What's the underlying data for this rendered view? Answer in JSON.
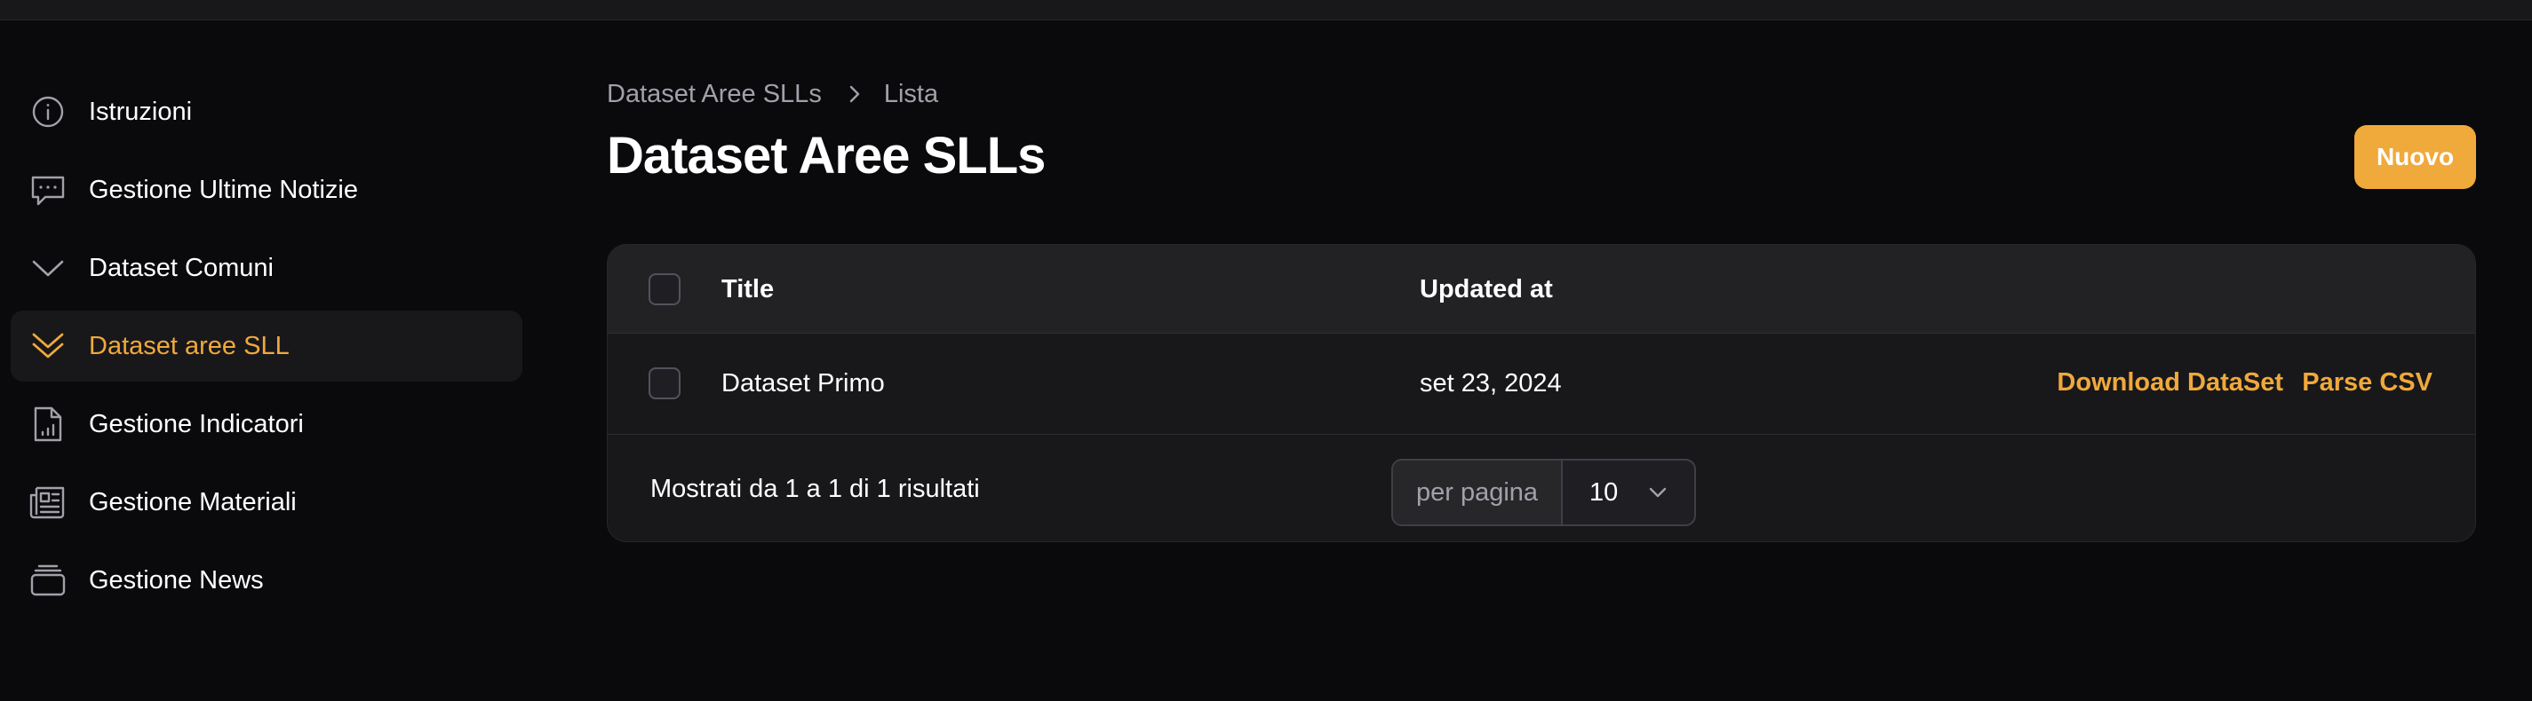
{
  "sidebar": {
    "items": [
      {
        "label": "Istruzioni",
        "icon": "info-circle-icon",
        "active": false
      },
      {
        "label": "Gestione Ultime Notizie",
        "icon": "chat-bubble-icon",
        "active": false
      },
      {
        "label": "Dataset Comuni",
        "icon": "chevron-down-icon",
        "active": false
      },
      {
        "label": "Dataset aree SLL",
        "icon": "double-chevron-down-icon",
        "active": true
      },
      {
        "label": "Gestione Indicatori",
        "icon": "document-chart-icon",
        "active": false
      },
      {
        "label": "Gestione Materiali",
        "icon": "newspaper-icon",
        "active": false
      },
      {
        "label": "Gestione News",
        "icon": "stack-icon",
        "active": false
      }
    ]
  },
  "breadcrumb": {
    "parent": "Dataset Aree SLLs",
    "current": "Lista"
  },
  "page": {
    "title": "Dataset Aree SLLs",
    "new_button": "Nuovo"
  },
  "table": {
    "columns": [
      "Title",
      "Updated at"
    ],
    "rows": [
      {
        "title": "Dataset Primo",
        "updated_at": "set 23, 2024",
        "actions": [
          "Download DataSet",
          "Parse CSV"
        ]
      }
    ]
  },
  "pagination": {
    "summary": "Mostrati da 1 a 1 di 1 risultati",
    "per_page_label": "per pagina",
    "per_page_value": "10"
  },
  "colors": {
    "accent": "#f0a93b",
    "background": "#0a0a0c",
    "card": "#18181b"
  }
}
